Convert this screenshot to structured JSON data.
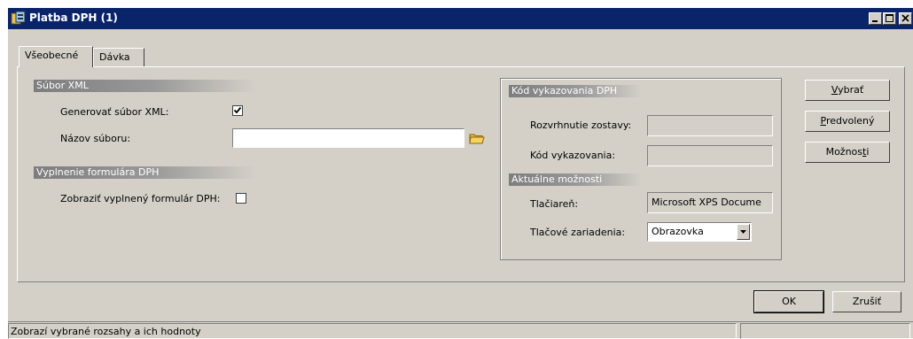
{
  "window": {
    "title": "Platba DPH (1)"
  },
  "tabs": [
    {
      "label": "Všeobecné",
      "active": true
    },
    {
      "label": "Dávka",
      "active": false
    }
  ],
  "xml_group": {
    "header": "Súbor XML",
    "generate_label": "Generovať súbor XML:",
    "generate_checked": true,
    "filename_label": "Názov súboru:",
    "filename_value": ""
  },
  "form_group": {
    "header": "Vyplnenie formulára DPH",
    "show_label": "Zobraziť vyplnený formulár DPH:",
    "show_checked": false
  },
  "report_group": {
    "header": "Kód vykazovania DPH",
    "layout_label": "Rozvrhnutie zostavy:",
    "layout_value": "",
    "code_label": "Kód vykazovania:",
    "code_value": ""
  },
  "options_group": {
    "header": "Aktuálne možnosti",
    "printer_label": "Tlačiareň:",
    "printer_value": "Microsoft XPS Docume",
    "device_label": "Tlačové zariadenia:",
    "device_value": "Obrazovka"
  },
  "side_buttons": {
    "select": {
      "pre": "",
      "key": "V",
      "post": "ybrať"
    },
    "default": {
      "pre": "",
      "key": "P",
      "post": "redvolený"
    },
    "options": {
      "pre": "Možnos",
      "key": "t",
      "post": "i"
    }
  },
  "footer_buttons": {
    "ok": "OK",
    "cancel": "Zrušiť"
  },
  "statusbar": {
    "text": "Zobrazí vybrané rozsahy a ich hodnoty"
  },
  "colors": {
    "titlebar": "#0a246a",
    "face": "#d4d0c8"
  }
}
